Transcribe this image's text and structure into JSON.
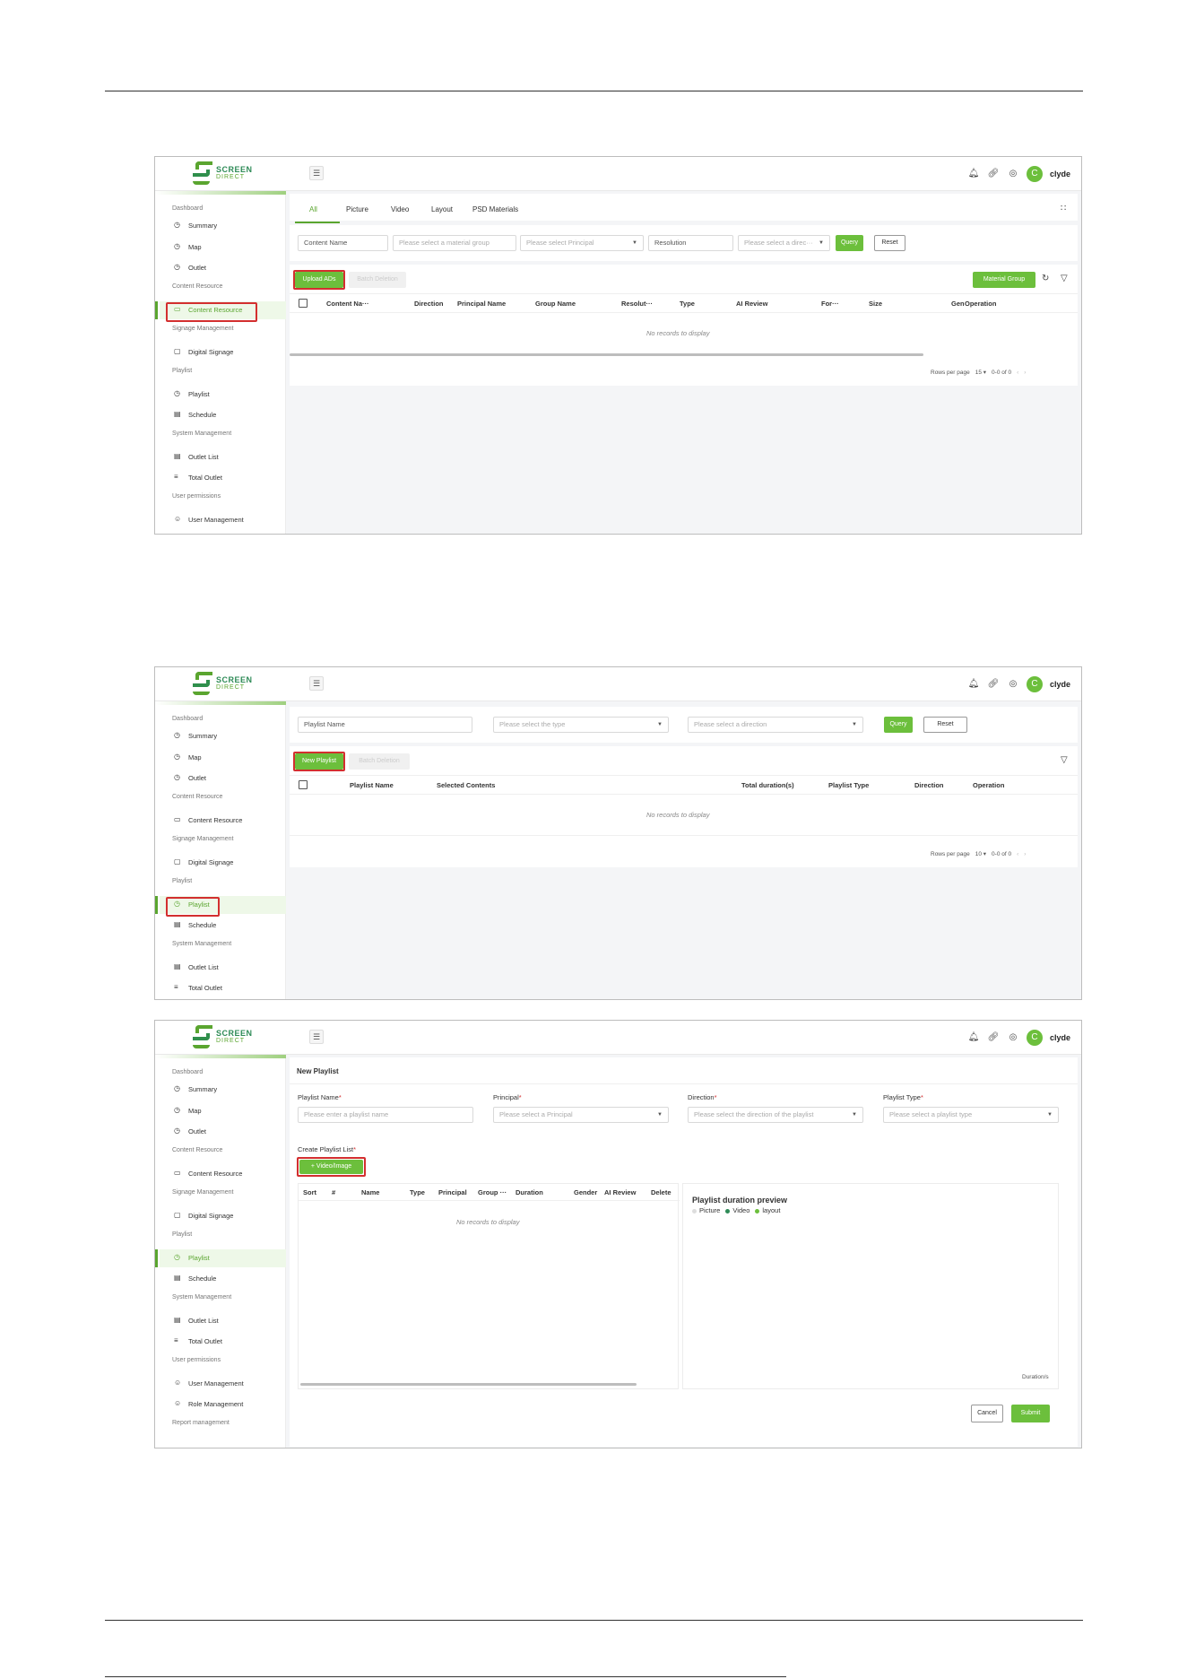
{
  "app": {
    "brand_top": "SCREEN",
    "brand_bottom": "DIRECT",
    "user_initial": "C",
    "user_name": "clyde",
    "menu_icon": "☰",
    "top_icons": [
      "bell-icon",
      "link-icon",
      "globe-icon"
    ],
    "accent_color": "#6cbf3c",
    "highlight_color": "#d32f2f"
  },
  "sidebar_a": {
    "g1": "Dashboard",
    "i1": "Summary",
    "i2": "Map",
    "i3": "Outlet",
    "g2": "Content Resource",
    "i4": "Content Resource",
    "g3": "Signage Management",
    "i5": "Digital Signage",
    "g4": "Playlist",
    "i6": "Playlist",
    "i7": "Schedule",
    "g5": "System Management",
    "i8": "Outlet List",
    "i9": "Total Outlet",
    "g6": "User permissions",
    "i10": "User Management"
  },
  "sidebar_b": {
    "g1": "Dashboard",
    "i1": "Summary",
    "i2": "Map",
    "i3": "Outlet",
    "g2": "Content Resource",
    "i4": "Content Resource",
    "g3": "Signage Management",
    "i5": "Digital Signage",
    "g4": "Playlist",
    "i6": "Playlist",
    "i7": "Schedule",
    "g5": "System Management",
    "i8": "Outlet List",
    "i9": "Total Outlet"
  },
  "sidebar_c": {
    "g1": "Dashboard",
    "i1": "Summary",
    "i2": "Map",
    "i3": "Outlet",
    "g2": "Content Resource",
    "i4": "Content Resource",
    "g3": "Signage Management",
    "i5": "Digital Signage",
    "g4": "Playlist",
    "i6": "Playlist",
    "i7": "Schedule",
    "g5": "System Management",
    "i8": "Outlet List",
    "i9": "Total Outlet",
    "g6": "User permissions",
    "i10": "User Management",
    "i11": "Role Management",
    "g7": "Report management"
  },
  "content": {
    "tabs": [
      "All",
      "Picture",
      "Video",
      "Layout",
      "PSD Materials"
    ],
    "filter_name": "Content Name",
    "filter_group": "Please select a material group",
    "filter_principal": "Please select Principal",
    "filter_resolution": "Resolution",
    "filter_direction": "Please select a direc···",
    "query": "Query",
    "reset": "Reset",
    "upload": "Upload ADs",
    "batch_delete": "Batch Deletion",
    "material_group": "Material Group",
    "columns": [
      "Content Na···",
      "Direction",
      "Principal Name",
      "Group Name",
      "Resolut···",
      "Type",
      "AI Review",
      "For···",
      "Size",
      "Gen",
      "Operation"
    ],
    "no_records": "No records to display",
    "rows_per_page_label": "Rows per page",
    "rows_per_page": "15",
    "range": "0-0 of 0"
  },
  "playlist": {
    "filter_name": "Playlist Name",
    "filter_type": "Please select the type",
    "filter_direction": "Please select a direction",
    "query": "Query",
    "reset": "Reset",
    "new_playlist": "New Playlist",
    "batch_delete": "Batch Deletion",
    "columns": [
      "Playlist Name",
      "Selected Contents",
      "Total duration(s)",
      "Playlist Type",
      "Direction",
      "Operation"
    ],
    "no_records": "No records to display",
    "rows_per_page_label": "Rows per page",
    "rows_per_page": "10",
    "range": "0-0 of 0"
  },
  "new_playlist": {
    "title": "New Playlist",
    "name_label": "Playlist Name",
    "name_placeholder": "Please enter a playlist name",
    "principal_label": "Principal",
    "principal_placeholder": "Please select a Principal",
    "direction_label": "Direction",
    "direction_placeholder": "Please select the direction of the playlist",
    "type_label": "Playlist Type",
    "type_placeholder": "Please select a playlist type",
    "required_mark": "*",
    "create_list_label": "Create Playlist List",
    "add_button": "+ Video/Image",
    "columns": [
      "Sort",
      "#",
      "Name",
      "Type",
      "Principal",
      "Group ···",
      "Duration",
      "Gender",
      "AI Review",
      "Delete"
    ],
    "no_records": "No records to display",
    "preview_title": "Playlist duration preview",
    "legend": [
      "Picture",
      "Video",
      "layout"
    ],
    "legend_colors": [
      "#dddddd",
      "#2e8b57",
      "#6cbf3c"
    ],
    "duration_label": "Duration/s",
    "cancel": "Cancel",
    "submit": "Submit"
  }
}
